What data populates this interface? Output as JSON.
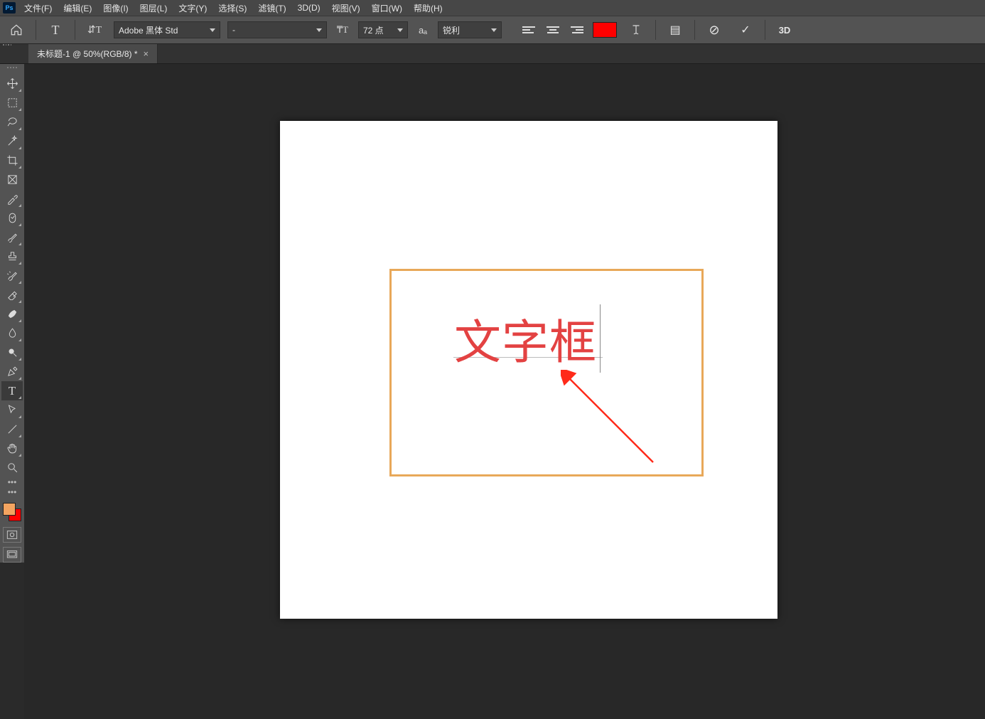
{
  "menu": {
    "items": [
      "文件(F)",
      "编辑(E)",
      "图像(I)",
      "图层(L)",
      "文字(Y)",
      "选择(S)",
      "滤镜(T)",
      "3D(D)",
      "视图(V)",
      "窗口(W)",
      "帮助(H)"
    ]
  },
  "options": {
    "home_label": "",
    "tool_glyph": "T",
    "orientation_glyph": "⇵T",
    "font_family": "Adobe 黑体 Std",
    "font_style": "-",
    "font_resize_glyph": "₸T",
    "font_size": "72 点",
    "aa_glyph": "aₐ",
    "anti_alias": "锐利",
    "text_color": "#ff0000",
    "warp_glyph": "I̩",
    "panel_glyph": "▤",
    "cancel_glyph": "⊘",
    "commit_glyph": "✓",
    "threeD_glyph": "3D"
  },
  "tab": {
    "label": "未标题-1 @ 50%(RGB/8) *"
  },
  "tools": [
    {
      "id": "move",
      "svg": "move"
    },
    {
      "id": "marquee",
      "svg": "marquee"
    },
    {
      "id": "lasso",
      "svg": "lasso"
    },
    {
      "id": "quick-select",
      "svg": "wand"
    },
    {
      "id": "crop",
      "svg": "crop"
    },
    {
      "id": "frame",
      "svg": "frame"
    },
    {
      "id": "eyedropper",
      "svg": "eyedropper"
    },
    {
      "id": "healing",
      "svg": "heal"
    },
    {
      "id": "brush",
      "svg": "brush"
    },
    {
      "id": "stamp",
      "svg": "stamp"
    },
    {
      "id": "history",
      "svg": "history"
    },
    {
      "id": "eraser",
      "svg": "eraser"
    },
    {
      "id": "gradient",
      "svg": "gradient"
    },
    {
      "id": "blur",
      "svg": "blur"
    },
    {
      "id": "dodge",
      "svg": "dodge"
    },
    {
      "id": "pen",
      "svg": "pen"
    },
    {
      "id": "type",
      "svg": "type",
      "active": true
    },
    {
      "id": "path",
      "svg": "path"
    },
    {
      "id": "line",
      "svg": "line"
    },
    {
      "id": "hand",
      "svg": "hand"
    },
    {
      "id": "zoom",
      "svg": "zoom"
    }
  ],
  "colors": {
    "fg": "#f4a460",
    "bg": "#ff0000"
  },
  "canvas": {
    "typed_text": "文字框"
  }
}
